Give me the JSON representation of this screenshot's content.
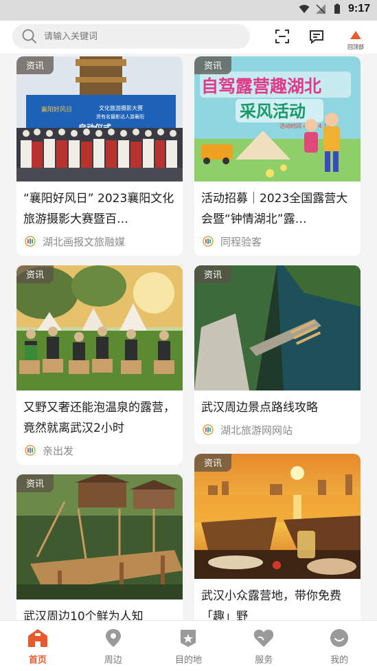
{
  "status_bar": {
    "time": "9:17"
  },
  "header": {
    "search_placeholder": "请输入关键词",
    "top_label": "回顶部"
  },
  "feed": {
    "left": [
      {
        "tag": "资讯",
        "title": "“襄阳好风日” 2023襄阳文化旅游摄影大赛暨百…",
        "source": "湖北画报文旅融媒"
      },
      {
        "tag": "资讯",
        "title": "又野又奢还能泡温泉的露营，竟然就离武汉2小时",
        "source": "亲出发"
      },
      {
        "tag": "资讯",
        "title": "武汉周边10个鲜为人知",
        "source": ""
      }
    ],
    "right": [
      {
        "tag": "资讯",
        "title": "活动招募｜2023全国露营大会暨“钟情湖北”露…",
        "source": "同程验客"
      },
      {
        "tag": "资讯",
        "title": "武汉周边景点路线攻略",
        "source": "湖北旅游网网站"
      },
      {
        "tag": "资讯",
        "title": "武汉小众露营地，带你免费「趣」野",
        "source": ""
      }
    ],
    "banner_text": {
      "camp_title_1": "自驾露营趣湖北",
      "camp_title_2": "采风活动",
      "camp_date": "活动时间 4.11–4.13",
      "ceremony_title": "启动仪式",
      "ceremony_sub": "文化旅游摄影大赛",
      "ceremony_sub2": "资有名摄影达人游襄阳",
      "ceremony_left": "襄阳好风日"
    }
  },
  "tabbar": {
    "items": [
      {
        "label": "首页",
        "active": true
      },
      {
        "label": "周边",
        "active": false
      },
      {
        "label": "目的地",
        "active": false
      },
      {
        "label": "服务",
        "active": false
      },
      {
        "label": "我的",
        "active": false
      }
    ]
  },
  "colors": {
    "accent": "#e85a2c",
    "tab_inactive": "#9a9a9a"
  }
}
